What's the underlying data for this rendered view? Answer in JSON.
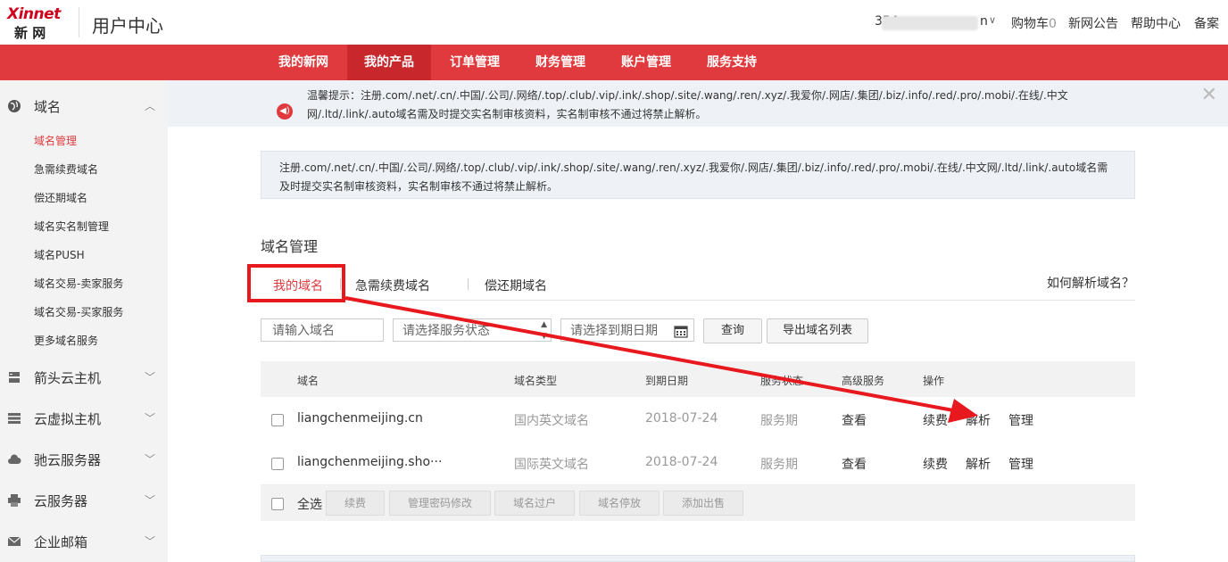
{
  "brand": {
    "logo_text": "Xinnet",
    "logo_cn": "新 网",
    "app_title": "用户中心"
  },
  "top_nav": {
    "user_prefix": "354",
    "user_suffix": "n",
    "cart_label": "购物车",
    "cart_count": "0",
    "announce": "新网公告",
    "help": "帮助中心",
    "beian": "备案"
  },
  "menu": [
    "我的新网",
    "我的产品",
    "订单管理",
    "财务管理",
    "账户管理",
    "服务支持"
  ],
  "notice": {
    "text": "温馨提示：注册.com/.net/.cn/.中国/.公司/.网络/.top/.club/.vip/.ink/.shop/.site/.wang/.ren/.xyz/.我爱你/.网店/.集团/.biz/.info/.red/.pro/.mobi/.在线/.中文网/.ltd/.link/.auto域名需及时提交实名制审核资料，实名制审核不通过将禁止解析。"
  },
  "sidebar": {
    "sections": [
      {
        "label": "域名",
        "icon": "globe-icon"
      },
      {
        "label": "箭头云主机",
        "icon": "server-icon"
      },
      {
        "label": "云虚拟主机",
        "icon": "stack-icon"
      },
      {
        "label": "驰云服务器",
        "icon": "cloud-icon"
      },
      {
        "label": "云服务器",
        "icon": "printer-icon"
      },
      {
        "label": "企业邮箱",
        "icon": "mail-icon"
      }
    ],
    "domain_items": [
      "域名管理",
      "急需续费域名",
      "偿还期域名",
      "域名实名制管理",
      "域名PUSH",
      "域名交易-卖家服务",
      "域名交易-买家服务",
      "更多域名服务"
    ]
  },
  "info_box": {
    "text": "注册.com/.net/.cn/.中国/.公司/.网络/.top/.club/.vip/.ink/.shop/.site/.wang/.ren/.xyz/.我爱你/.网店/.集团/.biz/.info/.red/.pro/.mobi/.在线/.中文网/.ltd/.link/.auto域名需及时提交实名制审核资料，实名制审核不通过将禁止解析。"
  },
  "page_title": "域名管理",
  "tabs": [
    "我的域名",
    "急需续费域名",
    "偿还期域名"
  ],
  "help_link": "如何解析域名？",
  "filters": {
    "domain_placeholder": "请输入域名",
    "status_placeholder": "请选择服务状态",
    "date_placeholder": "请选择到期日期",
    "query_btn": "查询",
    "export_btn": "导出域名列表"
  },
  "table": {
    "headers": [
      "域名",
      "域名类型",
      "到期日期",
      "服务状态",
      "高级服务",
      "操作"
    ],
    "rows": [
      {
        "domain": "liangchenmeijing.cn",
        "type": "国内英文域名",
        "expire": "2018-07-24",
        "status": "服务期",
        "advanced": "查看",
        "actions": [
          "续费",
          "解析",
          "管理"
        ]
      },
      {
        "domain": "liangchenmeijing.sho···",
        "type": "国际英文域名",
        "expire": "2018-07-24",
        "status": "服务期",
        "advanced": "查看",
        "actions": [
          "续费",
          "解析",
          "管理"
        ]
      }
    ],
    "select_all": "全选",
    "bulk_buttons": [
      "续费",
      "管理密码修改",
      "域名过户",
      "域名停放",
      "添加出售"
    ]
  },
  "colors": {
    "brand_red": "#e03a3e",
    "menu_active": "#c8282c",
    "annotation_red": "#e8191e",
    "notice_bg": "#eef2f7"
  }
}
